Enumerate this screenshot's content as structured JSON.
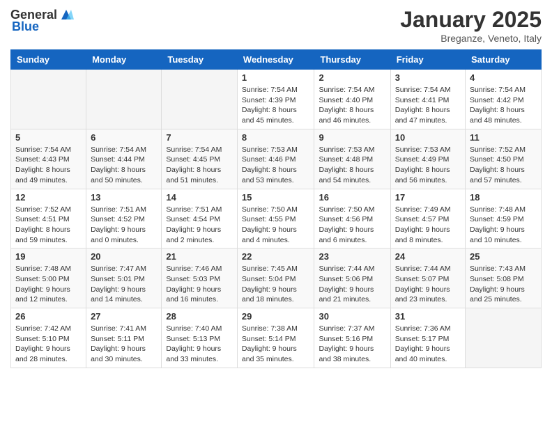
{
  "header": {
    "logo_general": "General",
    "logo_blue": "Blue",
    "month_title": "January 2025",
    "location": "Breganze, Veneto, Italy"
  },
  "weekdays": [
    "Sunday",
    "Monday",
    "Tuesday",
    "Wednesday",
    "Thursday",
    "Friday",
    "Saturday"
  ],
  "weeks": [
    [
      {
        "day": "",
        "info": ""
      },
      {
        "day": "",
        "info": ""
      },
      {
        "day": "",
        "info": ""
      },
      {
        "day": "1",
        "info": "Sunrise: 7:54 AM\nSunset: 4:39 PM\nDaylight: 8 hours\nand 45 minutes."
      },
      {
        "day": "2",
        "info": "Sunrise: 7:54 AM\nSunset: 4:40 PM\nDaylight: 8 hours\nand 46 minutes."
      },
      {
        "day": "3",
        "info": "Sunrise: 7:54 AM\nSunset: 4:41 PM\nDaylight: 8 hours\nand 47 minutes."
      },
      {
        "day": "4",
        "info": "Sunrise: 7:54 AM\nSunset: 4:42 PM\nDaylight: 8 hours\nand 48 minutes."
      }
    ],
    [
      {
        "day": "5",
        "info": "Sunrise: 7:54 AM\nSunset: 4:43 PM\nDaylight: 8 hours\nand 49 minutes."
      },
      {
        "day": "6",
        "info": "Sunrise: 7:54 AM\nSunset: 4:44 PM\nDaylight: 8 hours\nand 50 minutes."
      },
      {
        "day": "7",
        "info": "Sunrise: 7:54 AM\nSunset: 4:45 PM\nDaylight: 8 hours\nand 51 minutes."
      },
      {
        "day": "8",
        "info": "Sunrise: 7:53 AM\nSunset: 4:46 PM\nDaylight: 8 hours\nand 53 minutes."
      },
      {
        "day": "9",
        "info": "Sunrise: 7:53 AM\nSunset: 4:48 PM\nDaylight: 8 hours\nand 54 minutes."
      },
      {
        "day": "10",
        "info": "Sunrise: 7:53 AM\nSunset: 4:49 PM\nDaylight: 8 hours\nand 56 minutes."
      },
      {
        "day": "11",
        "info": "Sunrise: 7:52 AM\nSunset: 4:50 PM\nDaylight: 8 hours\nand 57 minutes."
      }
    ],
    [
      {
        "day": "12",
        "info": "Sunrise: 7:52 AM\nSunset: 4:51 PM\nDaylight: 8 hours\nand 59 minutes."
      },
      {
        "day": "13",
        "info": "Sunrise: 7:51 AM\nSunset: 4:52 PM\nDaylight: 9 hours\nand 0 minutes."
      },
      {
        "day": "14",
        "info": "Sunrise: 7:51 AM\nSunset: 4:54 PM\nDaylight: 9 hours\nand 2 minutes."
      },
      {
        "day": "15",
        "info": "Sunrise: 7:50 AM\nSunset: 4:55 PM\nDaylight: 9 hours\nand 4 minutes."
      },
      {
        "day": "16",
        "info": "Sunrise: 7:50 AM\nSunset: 4:56 PM\nDaylight: 9 hours\nand 6 minutes."
      },
      {
        "day": "17",
        "info": "Sunrise: 7:49 AM\nSunset: 4:57 PM\nDaylight: 9 hours\nand 8 minutes."
      },
      {
        "day": "18",
        "info": "Sunrise: 7:48 AM\nSunset: 4:59 PM\nDaylight: 9 hours\nand 10 minutes."
      }
    ],
    [
      {
        "day": "19",
        "info": "Sunrise: 7:48 AM\nSunset: 5:00 PM\nDaylight: 9 hours\nand 12 minutes."
      },
      {
        "day": "20",
        "info": "Sunrise: 7:47 AM\nSunset: 5:01 PM\nDaylight: 9 hours\nand 14 minutes."
      },
      {
        "day": "21",
        "info": "Sunrise: 7:46 AM\nSunset: 5:03 PM\nDaylight: 9 hours\nand 16 minutes."
      },
      {
        "day": "22",
        "info": "Sunrise: 7:45 AM\nSunset: 5:04 PM\nDaylight: 9 hours\nand 18 minutes."
      },
      {
        "day": "23",
        "info": "Sunrise: 7:44 AM\nSunset: 5:06 PM\nDaylight: 9 hours\nand 21 minutes."
      },
      {
        "day": "24",
        "info": "Sunrise: 7:44 AM\nSunset: 5:07 PM\nDaylight: 9 hours\nand 23 minutes."
      },
      {
        "day": "25",
        "info": "Sunrise: 7:43 AM\nSunset: 5:08 PM\nDaylight: 9 hours\nand 25 minutes."
      }
    ],
    [
      {
        "day": "26",
        "info": "Sunrise: 7:42 AM\nSunset: 5:10 PM\nDaylight: 9 hours\nand 28 minutes."
      },
      {
        "day": "27",
        "info": "Sunrise: 7:41 AM\nSunset: 5:11 PM\nDaylight: 9 hours\nand 30 minutes."
      },
      {
        "day": "28",
        "info": "Sunrise: 7:40 AM\nSunset: 5:13 PM\nDaylight: 9 hours\nand 33 minutes."
      },
      {
        "day": "29",
        "info": "Sunrise: 7:38 AM\nSunset: 5:14 PM\nDaylight: 9 hours\nand 35 minutes."
      },
      {
        "day": "30",
        "info": "Sunrise: 7:37 AM\nSunset: 5:16 PM\nDaylight: 9 hours\nand 38 minutes."
      },
      {
        "day": "31",
        "info": "Sunrise: 7:36 AM\nSunset: 5:17 PM\nDaylight: 9 hours\nand 40 minutes."
      },
      {
        "day": "",
        "info": ""
      }
    ]
  ]
}
